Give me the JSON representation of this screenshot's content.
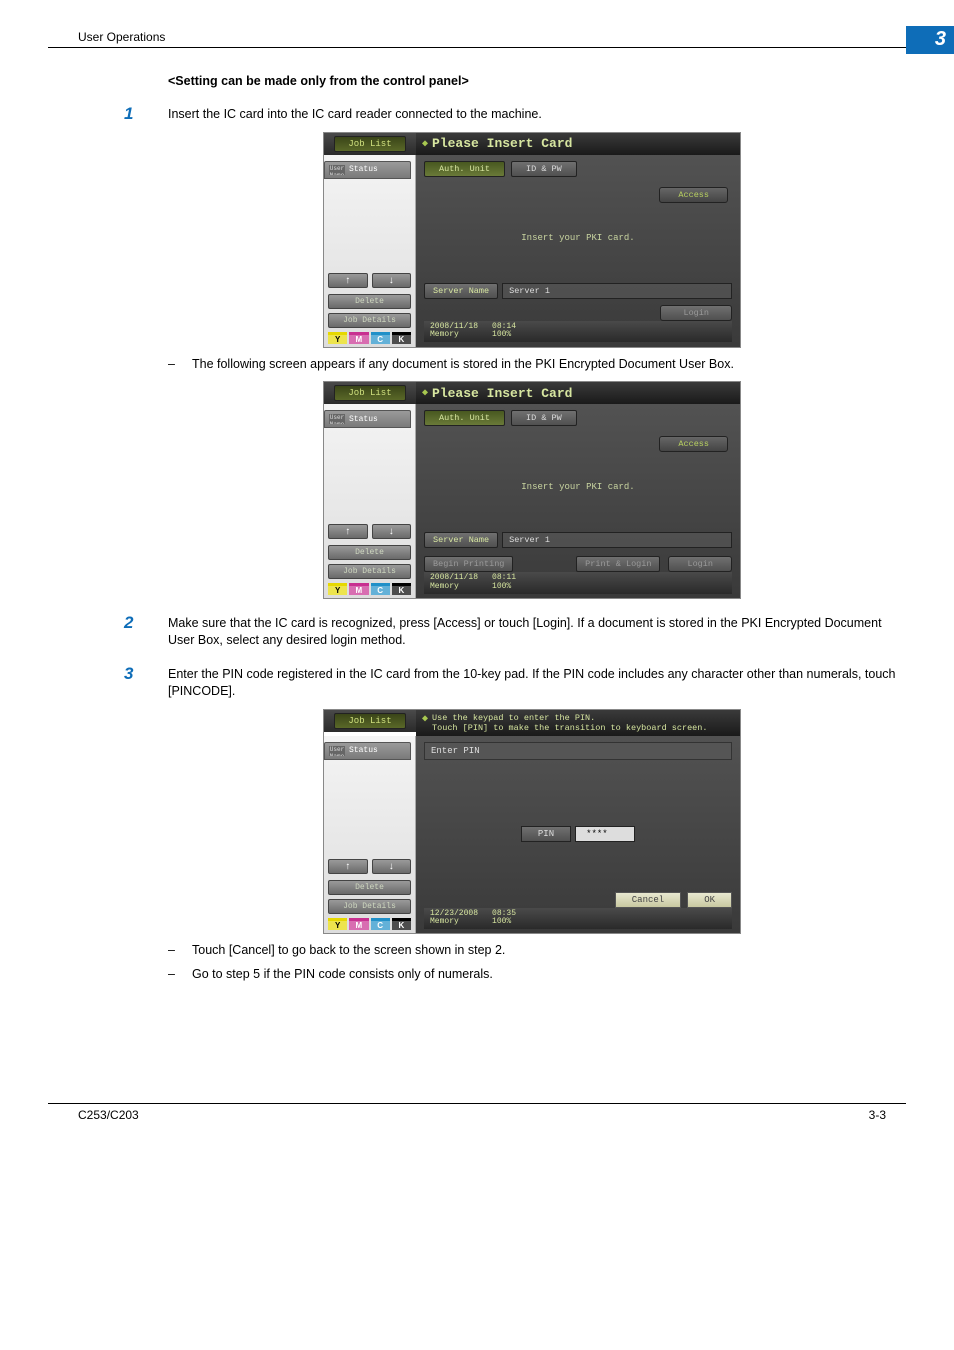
{
  "header": {
    "section": "User Operations",
    "chapter": "3"
  },
  "subheading": "<Setting can be made only from the control panel>",
  "steps": {
    "s1": {
      "num": "1",
      "text": "Insert the IC card into the IC card reader connected to the machine."
    },
    "s1_bullet": "The following screen appears if any document is stored in the PKI Encrypted Document User Box.",
    "s2": {
      "num": "2",
      "text": "Make sure that the IC card is recognized, press [Access] or touch [Login]. If a document is stored in the PKI Encrypted Document User Box, select any desired login method."
    },
    "s3": {
      "num": "3",
      "text": "Enter the PIN code registered in the IC card from the 10-key pad. If the PIN code includes any character other than numerals, touch [PINCODE]."
    },
    "s3_bullets": [
      "Touch [Cancel] to go back to the screen shown in step 2.",
      "Go to step 5 if the PIN code consists only of numerals."
    ]
  },
  "dev_common": {
    "job_list": "Job List",
    "user_status": "Status",
    "user_name_mini": "User Name",
    "up": "↑",
    "down": "↓",
    "delete": "Delete",
    "job_details": "Job Details",
    "toner": {
      "y": "Y",
      "m": "M",
      "c": "C",
      "k": "K"
    }
  },
  "dev1": {
    "title": "Please Insert Card",
    "tab_auth": "Auth. Unit",
    "tab_idpw": "ID & PW",
    "access": "Access",
    "msg": "Insert your PKI card.",
    "server_name": "Server Name",
    "server_val": "Server 1",
    "login": "Login",
    "footer": {
      "date": "2008/11/18",
      "time": "08:14",
      "mem": "Memory",
      "mem_val": "100%"
    }
  },
  "dev2": {
    "title": "Please Insert Card",
    "tab_auth": "Auth. Unit",
    "tab_idpw": "ID & PW",
    "access": "Access",
    "msg": "Insert your PKI card.",
    "server_name": "Server Name",
    "server_val": "Server 1",
    "begin_printing": "Begin Printing",
    "print_login": "Print & Login",
    "login": "Login",
    "footer": {
      "date": "2008/11/18",
      "time": "08:11",
      "mem": "Memory",
      "mem_val": "100%"
    }
  },
  "dev3": {
    "title_line1": "Use the keypad to enter the PIN.",
    "title_line2": "Touch [PIN] to make the transition to keyboard screen.",
    "panel": "Enter PIN",
    "pin_lbl": "PIN",
    "pin_val": "****",
    "cancel": "Cancel",
    "ok": "OK",
    "footer": {
      "date": "12/23/2008",
      "time": "08:35",
      "mem": "Memory",
      "mem_val": "100%"
    }
  },
  "footer": {
    "left": "C253/C203",
    "right": "3-3"
  }
}
